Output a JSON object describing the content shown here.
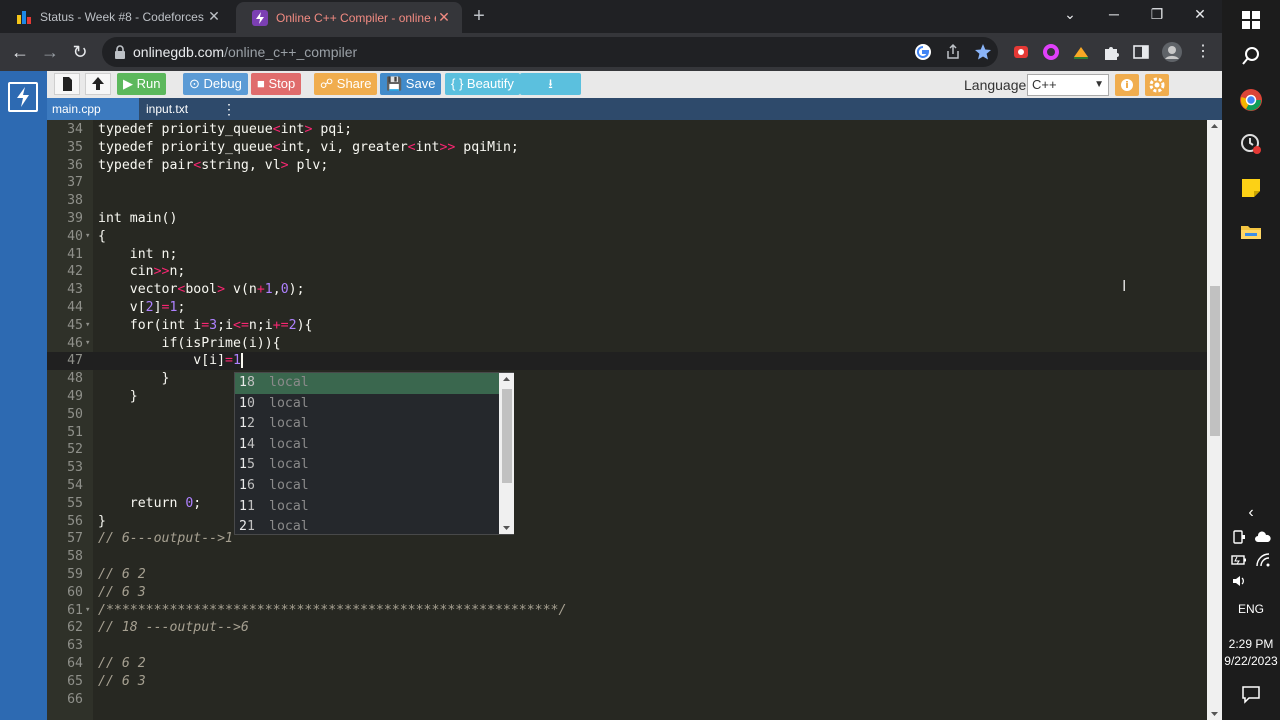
{
  "browser": {
    "tabs": [
      {
        "title": "Status - Week #8 - Codeforces",
        "close": "✕"
      },
      {
        "title": "Online C++ Compiler - online ed",
        "close": "✕"
      }
    ],
    "new_tab": "+",
    "url_host": "onlinegdb.com",
    "url_path": "/online_c++_compiler",
    "window_controls": {
      "minimize": "─",
      "restore": "❐",
      "close": "✕"
    }
  },
  "toolbar": {
    "run": "▶ Run",
    "debug": "⊙ Debug",
    "stop": "■ Stop",
    "share": "☍ Share",
    "save": "💾 Save",
    "beautify": "{ } Beautify",
    "download": "⭳",
    "language_label": "Language",
    "language_value": "C++"
  },
  "files": {
    "tabs": [
      "main.cpp",
      "input.txt"
    ],
    "menu": "⋮"
  },
  "editor": {
    "lines": [
      {
        "n": "34",
        "text": "typedef priority_queue<int> pqi;"
      },
      {
        "n": "35",
        "text": "typedef priority_queue<int, vi, greater<int>> pqiMin;"
      },
      {
        "n": "36",
        "text": "typedef pair<string, vl> plv;"
      },
      {
        "n": "37",
        "text": ""
      },
      {
        "n": "38",
        "text": ""
      },
      {
        "n": "39",
        "text": "int main()"
      },
      {
        "n": "40",
        "text": "{",
        "fold": true
      },
      {
        "n": "41",
        "text": "    int n;"
      },
      {
        "n": "42",
        "text": "    cin>>n;"
      },
      {
        "n": "43",
        "text": "    vector<bool> v(n+1,0);"
      },
      {
        "n": "44",
        "text": "    v[2]=1;"
      },
      {
        "n": "45",
        "text": "    for(int i=3;i<=n;i+=2){",
        "fold": true
      },
      {
        "n": "46",
        "text": "        if(isPrime(i)){",
        "fold": true
      },
      {
        "n": "47",
        "text": "            v[i]=1",
        "cursor": true
      },
      {
        "n": "48",
        "text": "        }"
      },
      {
        "n": "49",
        "text": "    }"
      },
      {
        "n": "50",
        "text": ""
      },
      {
        "n": "51",
        "text": ""
      },
      {
        "n": "52",
        "text": ""
      },
      {
        "n": "53",
        "text": ""
      },
      {
        "n": "54",
        "text": ""
      },
      {
        "n": "55",
        "text": "    return 0;"
      },
      {
        "n": "56",
        "text": "}"
      },
      {
        "n": "57",
        "text": "// 6---output-->1",
        "comment": true
      },
      {
        "n": "58",
        "text": ""
      },
      {
        "n": "59",
        "text": "// 6 2",
        "comment": true
      },
      {
        "n": "60",
        "text": "// 6 3",
        "comment": true
      },
      {
        "n": "61",
        "text": "/*********************************************************/",
        "comment": true,
        "fold": true
      },
      {
        "n": "62",
        "text": "// 18 ---output-->6",
        "comment": true
      },
      {
        "n": "63",
        "text": ""
      },
      {
        "n": "64",
        "text": "// 6 2",
        "comment": true
      },
      {
        "n": "65",
        "text": "// 6 3",
        "comment": true
      },
      {
        "n": "66",
        "text": ""
      }
    ],
    "autocomplete": [
      {
        "value": "18",
        "meta": "local"
      },
      {
        "value": "10",
        "meta": "local"
      },
      {
        "value": "12",
        "meta": "local"
      },
      {
        "value": "14",
        "meta": "local"
      },
      {
        "value": "15",
        "meta": "local"
      },
      {
        "value": "16",
        "meta": "local"
      },
      {
        "value": "11",
        "meta": "local"
      },
      {
        "value": "21",
        "meta": "local"
      }
    ]
  },
  "taskbar": {
    "language": "ENG",
    "time": "2:29 PM",
    "date": "9/22/2023",
    "chevron": "‹"
  }
}
